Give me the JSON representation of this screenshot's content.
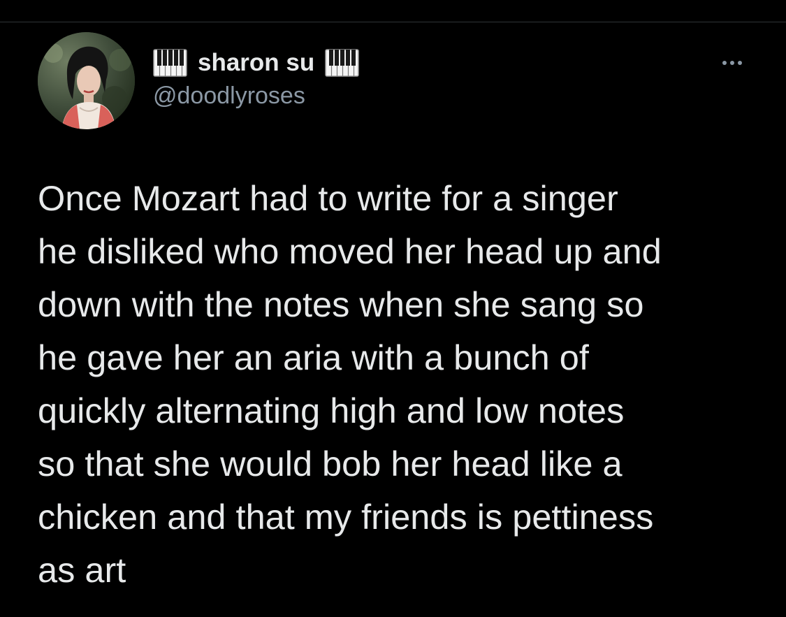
{
  "tweet": {
    "author": {
      "display_name": "sharon su",
      "handle": "@doodlyroses",
      "avatar_icon": "profile-photo",
      "name_prefix_icon": "piano-keys-icon",
      "name_suffix_icon": "piano-keys-icon"
    },
    "more_options_icon": "more-horizontal-icon",
    "text": "Once Mozart had to write for a singer\nhe disliked who moved her head up and\ndown with the notes when she sang so\nhe gave her an aria with a bunch of\nquickly alternating high and low notes\nso that she would bob her head like a\nchicken and that my friends is pettiness\nas art"
  },
  "colors": {
    "background": "#000000",
    "primary_text": "#e7e9ea",
    "secondary_text": "#8b98a5",
    "divider": "#2f3336"
  }
}
